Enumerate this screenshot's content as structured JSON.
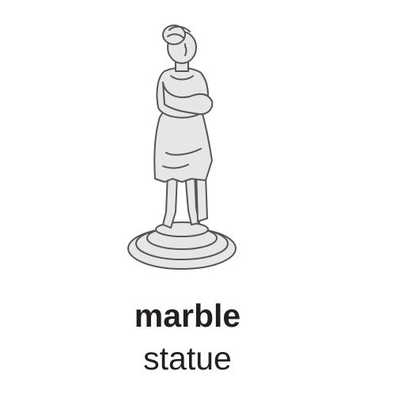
{
  "illustration": {
    "icon": "marble-statue-icon",
    "fill_color": "#e6e6e6",
    "stroke_color": "#555555"
  },
  "caption": {
    "material": "marble",
    "object": "statue",
    "text_color": "#231f20"
  }
}
